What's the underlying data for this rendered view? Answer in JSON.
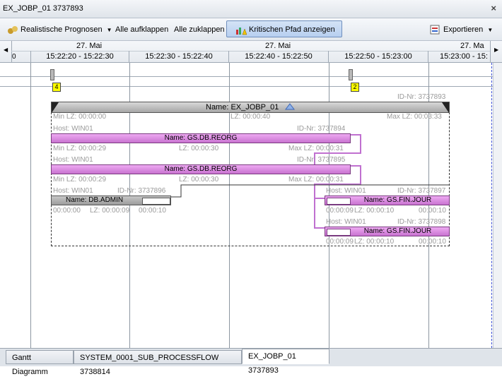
{
  "window": {
    "title": "EX_JOBP_01 3737893",
    "close_glyph": "×"
  },
  "toolbar": {
    "prognosen_label": "Realistische Prognosen",
    "expand_all_label": "Alle aufklappen",
    "collapse_all_label": "Alle zuklappen",
    "critical_path_label": "Kritischen Pfad anzeigen",
    "export_label": "Exportieren"
  },
  "timeline": {
    "dates": [
      "27. Mai",
      "27. Mai",
      "27. Ma"
    ],
    "slots": [
      "15:22:20 - 15:22:30",
      "15:22:30 - 15:22:40",
      "15:22:40 - 15:22:50",
      "15:22:50 - 15:23:00",
      "15:23:00 - 15:"
    ],
    "left_fragment": "0",
    "markers": [
      "4",
      "2"
    ]
  },
  "job": {
    "id": "ID-Nr: 3737893",
    "name": "Name: EX_JOBP_01",
    "min_lz": "Min LZ: 00:00:00",
    "lz": "LZ: 00:00:40",
    "max_lz": "Max LZ: 00:03:33"
  },
  "tasks": [
    {
      "host": "Host: WIN01",
      "id": "ID-Nr: 3737894",
      "name": "Name: GS.DB.REORG",
      "min": "Min LZ: 00:00:29",
      "lz": "LZ: 00:00:30",
      "max": "Max LZ: 00:00:31"
    },
    {
      "host": "Host: WIN01",
      "id": "ID-Nr: 3737895",
      "name": "Name: GS.DB.REORG",
      "min": "Min LZ: 00:00:29",
      "lz": "LZ: 00:00:30",
      "max": "Max LZ: 00:00:31"
    },
    {
      "host": "Host: WIN01",
      "id": "ID-Nr: 3737896",
      "name": "Name: DB.ADMIN",
      "min": "00:00:00",
      "lz": "LZ: 00:00:09",
      "max": "00:00:10"
    },
    {
      "host": "Host: WIN01",
      "id": "ID-Nr: 3737897",
      "name": "Name: GS.FIN.JOUR",
      "min": "00:00:09",
      "lz": "LZ: 00:00:10",
      "max": "00:00:10"
    },
    {
      "host": "Host: WIN01",
      "id": "ID-Nr: 3737898",
      "name": "Name: GS.FIN.JOUR",
      "min": "00:00:09",
      "lz": "LZ: 00:00:10",
      "max": "00:00:10"
    }
  ],
  "tabs": [
    "Gantt Diagramm",
    "SYSTEM_0001_SUB_PROCESSFLOW 3738814",
    "EX_JOBP_01 3737893"
  ],
  "colors": {
    "task_bar": "#d98bdf",
    "critical_path": "#c070d0",
    "accent": "#b7cff0"
  }
}
